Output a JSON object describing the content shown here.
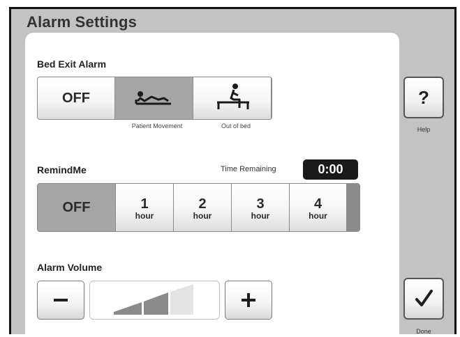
{
  "title": "Alarm Settings",
  "bed_exit": {
    "label": "Bed Exit Alarm",
    "options": [
      {
        "name": "off",
        "text": "OFF",
        "selected": false
      },
      {
        "name": "patient-movement",
        "icon": "patient-lying-icon",
        "caption": "Patient Movement",
        "selected": true
      },
      {
        "name": "out-of-bed",
        "icon": "patient-sitting-icon",
        "caption": "Out of bed",
        "selected": false
      }
    ]
  },
  "remind_me": {
    "label": "RemindMe",
    "time_remaining_label": "Time Remaining",
    "time_remaining_value": "0:00",
    "off_text": "OFF",
    "unit": "hour",
    "hours": [
      "1",
      "2",
      "3",
      "4"
    ],
    "selected": "OFF"
  },
  "alarm_volume": {
    "label": "Alarm Volume",
    "level": 2,
    "max_level": 3,
    "minus_icon": "minus-icon",
    "plus_icon": "plus-icon"
  },
  "help": {
    "symbol": "?",
    "caption": "Help"
  },
  "done": {
    "icon": "checkmark-icon",
    "caption": "Done"
  },
  "colors": {
    "frame": "#c3c3c3",
    "selected": "#a6a6a6",
    "timer_bg": "#1a1a1a",
    "volume_active": "#8a8a8a",
    "volume_inactive": "#e3e3e3"
  }
}
